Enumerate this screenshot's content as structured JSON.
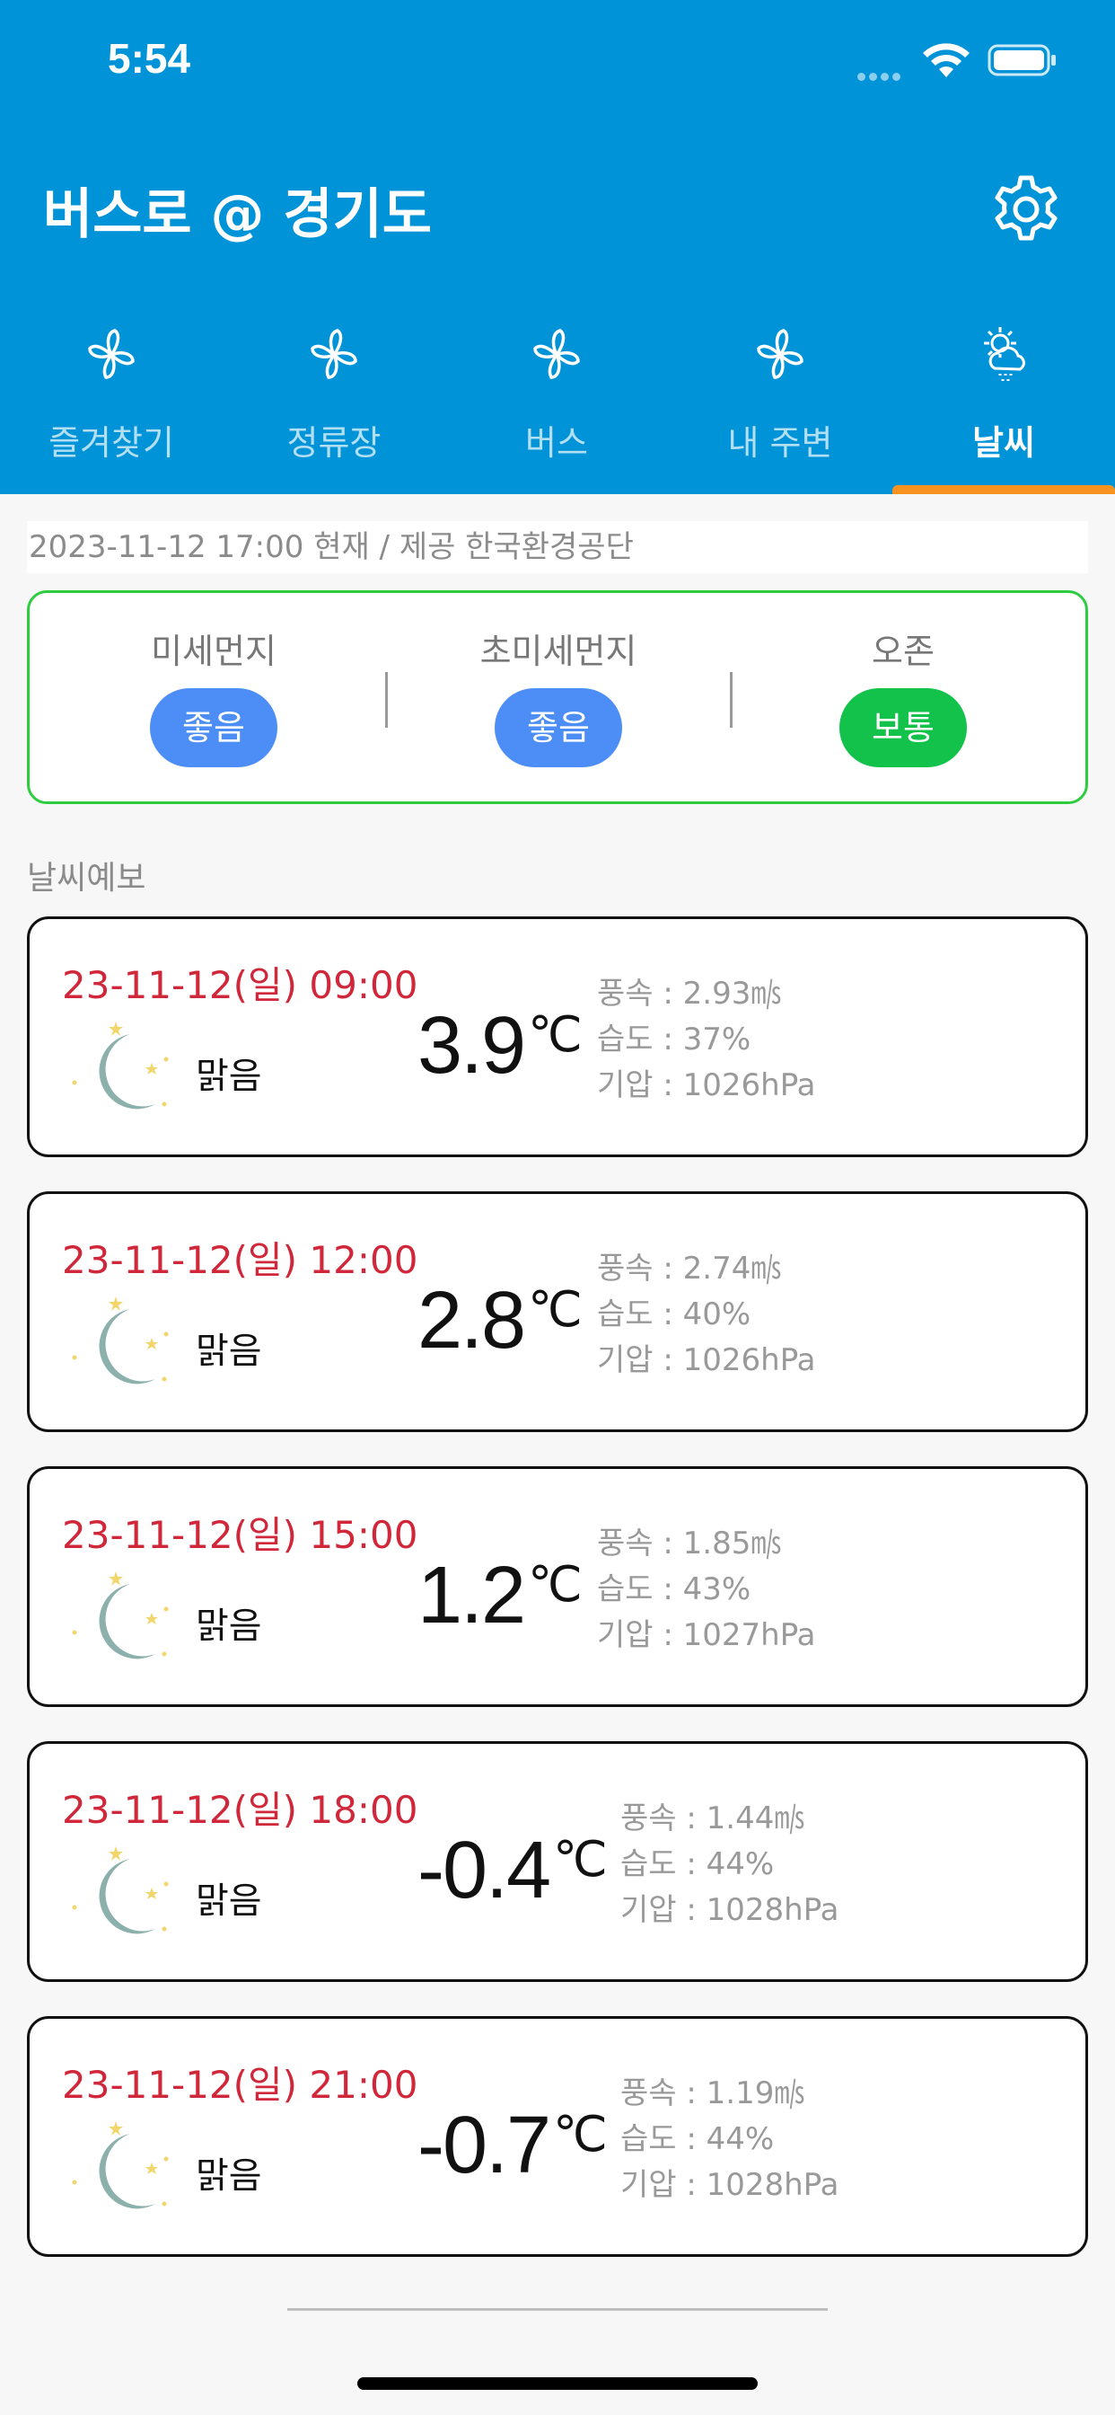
{
  "status_bar": {
    "time": "5:54"
  },
  "header": {
    "title": "버스로 @ 경기도",
    "settings_icon": "gear-icon"
  },
  "tabs": [
    {
      "label": "즐겨찾기",
      "icon": "pinwheel-icon",
      "active": false
    },
    {
      "label": "정류장",
      "icon": "pinwheel-icon",
      "active": false
    },
    {
      "label": "버스",
      "icon": "pinwheel-icon",
      "active": false
    },
    {
      "label": "내 주변",
      "icon": "pinwheel-icon",
      "active": false
    },
    {
      "label": "날씨",
      "icon": "weather-cloud-sun-icon",
      "active": true
    }
  ],
  "colors": {
    "header_bg": "#0193d8",
    "tab_indicator": "#f7931e",
    "pill_good": "#4c8ef5",
    "pill_normal": "#12c24a",
    "date_red": "#d0283a"
  },
  "air_quality": {
    "timestamp": "2023-11-12 17:00 현재 / 제공 한국환경공단",
    "items": [
      {
        "label": "미세먼지",
        "status": "좋음",
        "color": "#4c8ef5"
      },
      {
        "label": "초미세먼지",
        "status": "좋음",
        "color": "#4c8ef5"
      },
      {
        "label": "오존",
        "status": "보통",
        "color": "#12c24a"
      }
    ]
  },
  "forecast": {
    "title": "날씨예보",
    "cards": [
      {
        "date": "23-11-12(일) 09:00",
        "condition": "맑음",
        "temp": "3.9",
        "unit": "℃",
        "wind": "풍속 : 2.93㎧",
        "humidity": "습도 : 37%",
        "pressure": "기압 : 1026hPa"
      },
      {
        "date": "23-11-12(일) 12:00",
        "condition": "맑음",
        "temp": "2.8",
        "unit": "℃",
        "wind": "풍속 : 2.74㎧",
        "humidity": "습도 : 40%",
        "pressure": "기압 : 1026hPa"
      },
      {
        "date": "23-11-12(일) 15:00",
        "condition": "맑음",
        "temp": "1.2",
        "unit": "℃",
        "wind": "풍속 : 1.85㎧",
        "humidity": "습도 : 43%",
        "pressure": "기압 : 1027hPa"
      },
      {
        "date": "23-11-12(일) 18:00",
        "condition": "맑음",
        "temp": "-0.4",
        "unit": "℃",
        "wind": "풍속 : 1.44㎧",
        "humidity": "습도 : 44%",
        "pressure": "기압 : 1028hPa"
      },
      {
        "date": "23-11-12(일) 21:00",
        "condition": "맑음",
        "temp": "-0.7",
        "unit": "℃",
        "wind": "풍속 : 1.19㎧",
        "humidity": "습도 : 44%",
        "pressure": "기압 : 1028hPa"
      }
    ]
  }
}
